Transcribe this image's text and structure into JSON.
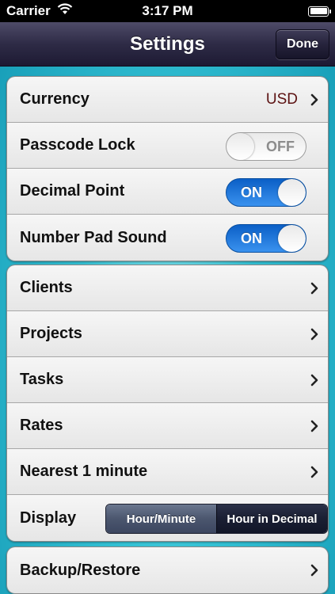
{
  "status_bar": {
    "carrier": "Carrier",
    "time": "3:17 PM",
    "wifi_icon": "wifi-icon",
    "battery_icon": "battery-icon"
  },
  "nav": {
    "title": "Settings",
    "done_label": "Done"
  },
  "group1": {
    "currency": {
      "label": "Currency",
      "value": "USD"
    },
    "passcode_lock": {
      "label": "Passcode Lock",
      "state": "OFF"
    },
    "decimal_point": {
      "label": "Decimal Point",
      "state": "ON"
    },
    "number_pad_sound": {
      "label": "Number Pad Sound",
      "state": "ON"
    }
  },
  "group2": {
    "clients": {
      "label": "Clients"
    },
    "projects": {
      "label": "Projects"
    },
    "tasks": {
      "label": "Tasks"
    },
    "rates": {
      "label": "Rates"
    },
    "rounding": {
      "label": "Nearest 1 minute"
    },
    "display": {
      "label": "Display",
      "options": [
        "Hour/Minute",
        "Hour in Decimal"
      ],
      "selected": "Hour/Minute"
    }
  },
  "group3": {
    "backup": {
      "label": "Backup/Restore"
    }
  },
  "colors": {
    "nav_bg": "#2e2b46",
    "toggle_on": "#1f78da",
    "value_text": "#5c1212",
    "background": "#35c3d6"
  }
}
